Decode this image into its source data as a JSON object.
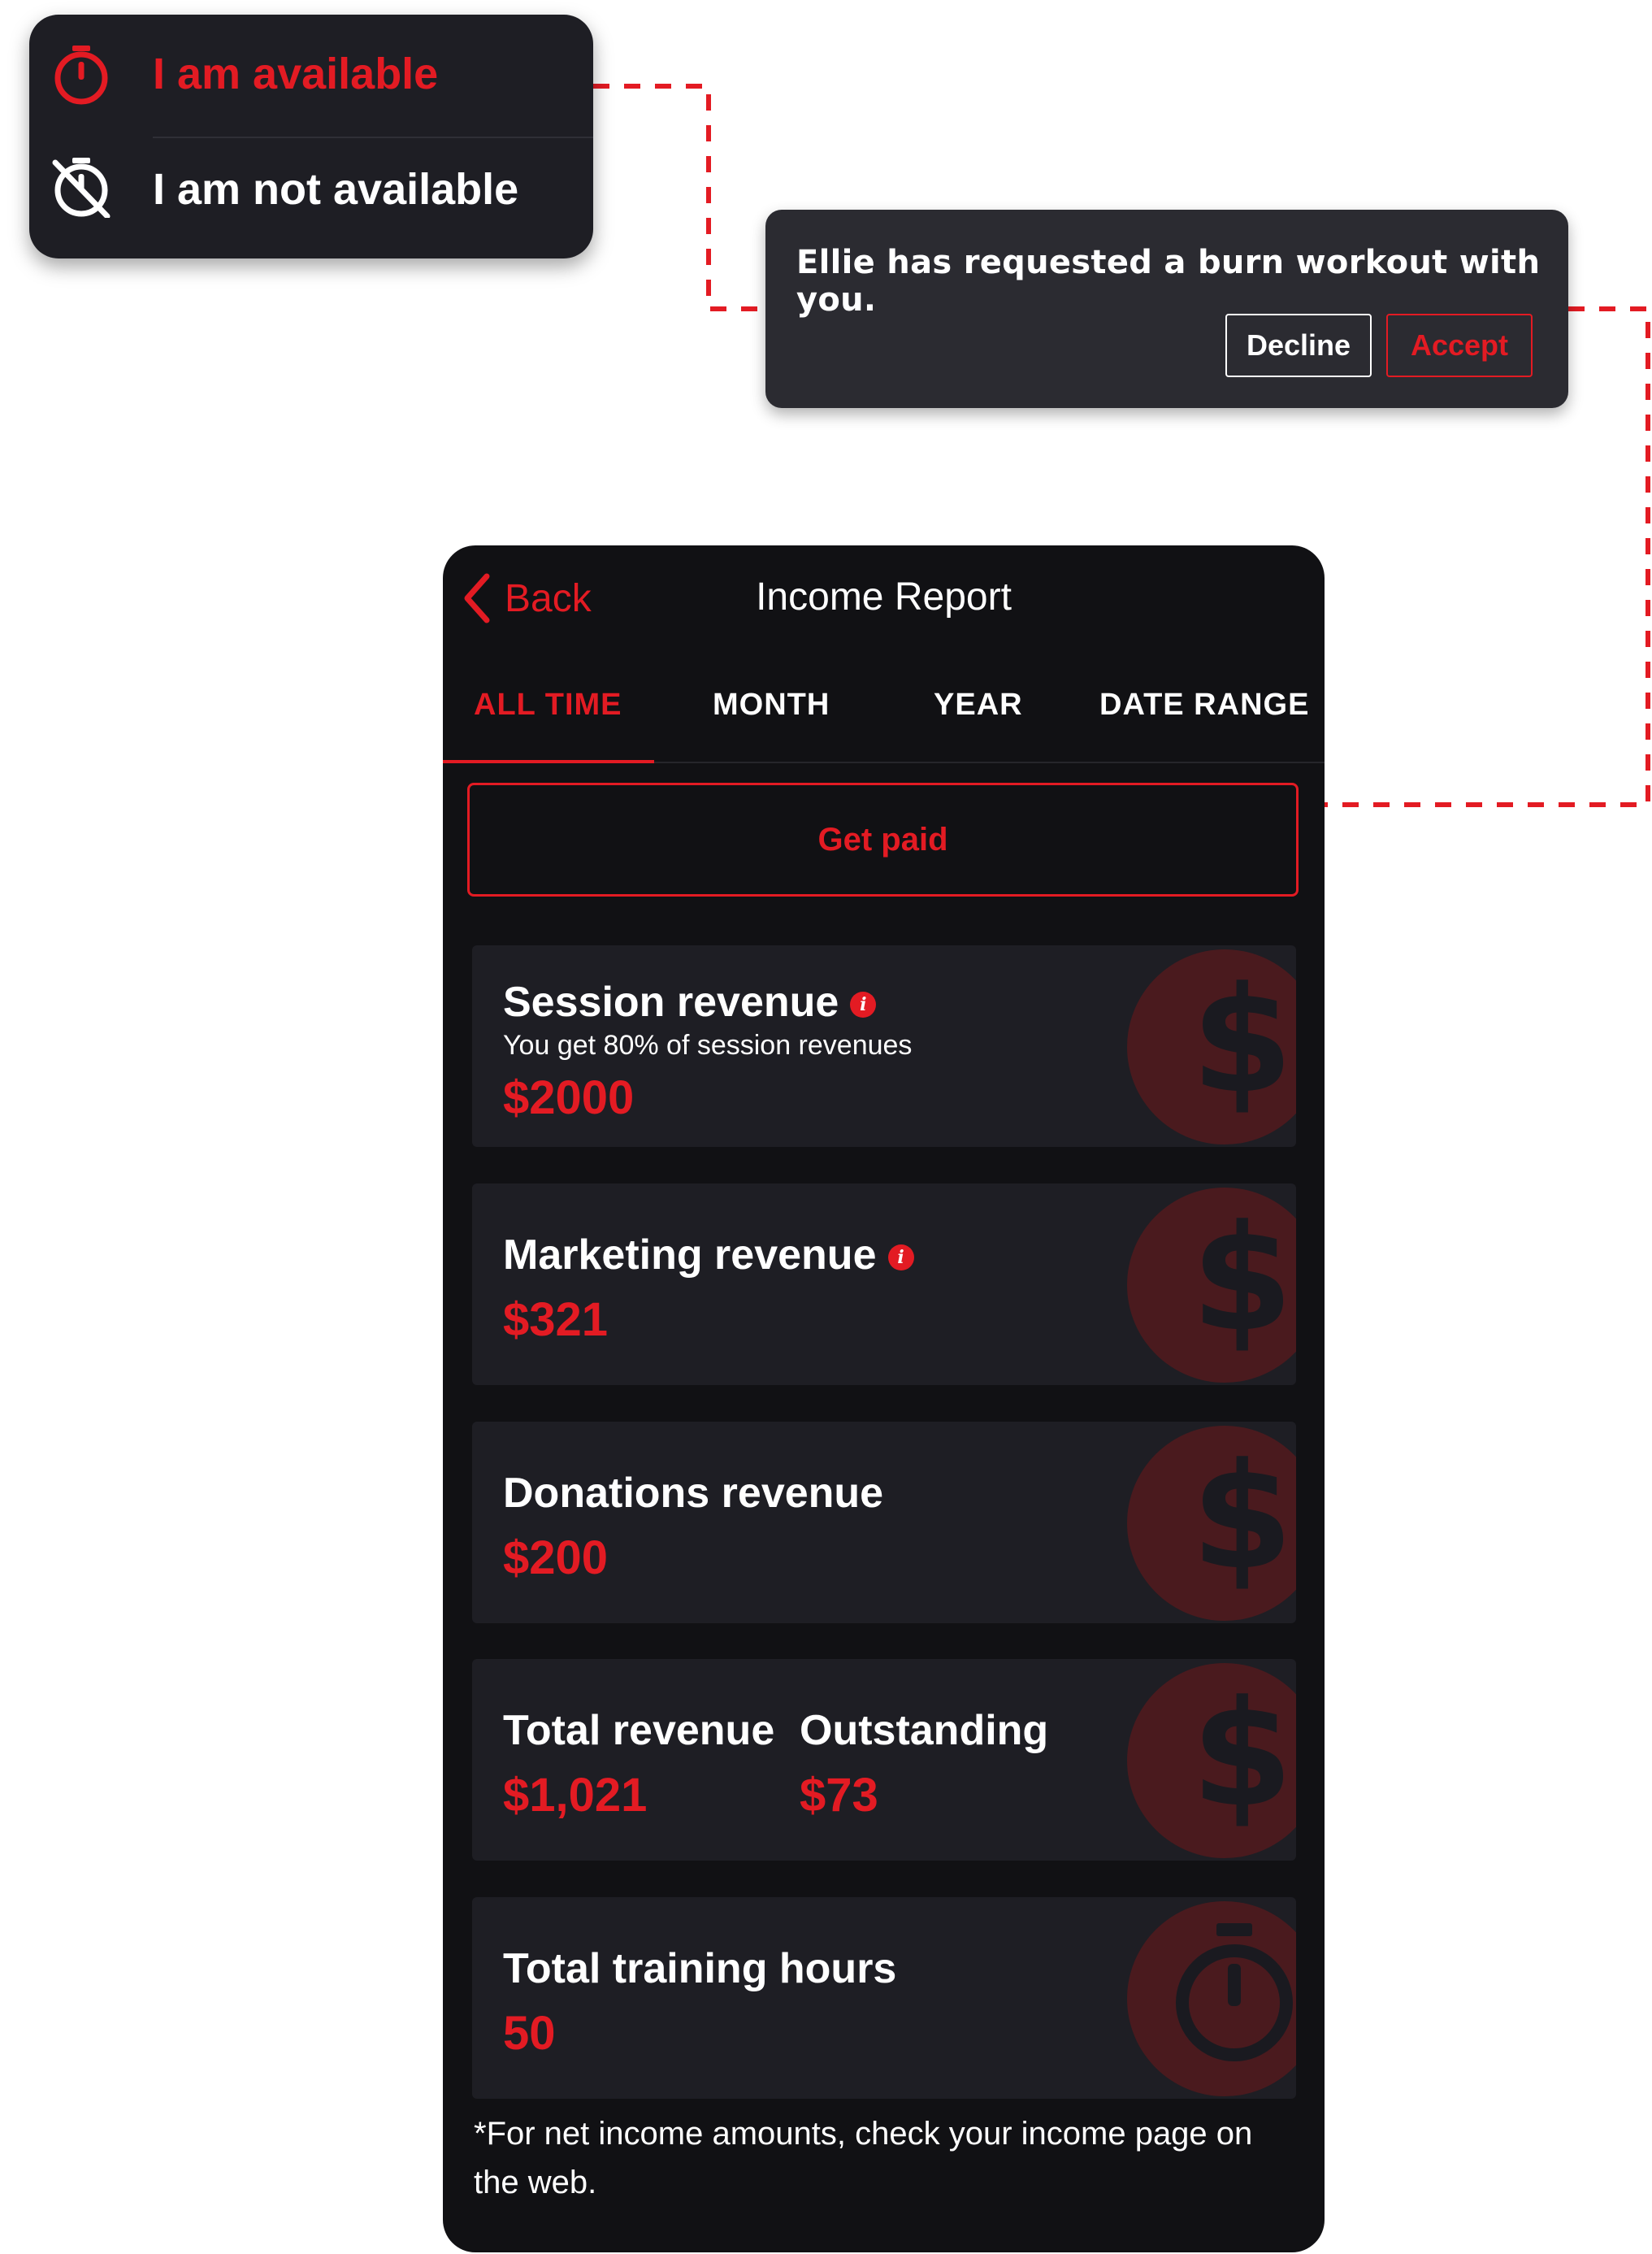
{
  "availability_menu": {
    "items": [
      {
        "label": "I am available",
        "icon": "stopwatch-icon",
        "color": "#e31b23"
      },
      {
        "label": "I am not available",
        "icon": "stopwatch-off-icon",
        "color": "#ffffff"
      }
    ]
  },
  "notification": {
    "message": "Ellie has requested a burn workout with you.",
    "decline_label": "Decline",
    "accept_label": "Accept"
  },
  "header": {
    "back_label": "Back",
    "title": "Income Report"
  },
  "tabs": [
    {
      "label": "ALL TIME",
      "active": true
    },
    {
      "label": "MONTH",
      "active": false
    },
    {
      "label": "YEAR",
      "active": false
    },
    {
      "label": "DATE RANGE",
      "active": false
    }
  ],
  "get_paid_label": "Get paid",
  "cards": {
    "session": {
      "title": "Session revenue",
      "subtitle": "You get 80% of session revenues",
      "value": "$2000",
      "icon": "dollar-icon"
    },
    "marketing": {
      "title": "Marketing revenue",
      "value": "$321",
      "icon": "dollar-icon"
    },
    "donations": {
      "title": "Donations revenue",
      "value": "$200",
      "icon": "dollar-icon"
    },
    "totals": {
      "total_title": "Total revenue",
      "total_value": "$1,021",
      "outstanding_title": "Outstanding",
      "outstanding_value": "$73",
      "icon": "dollar-icon"
    },
    "hours": {
      "title": "Total training hours",
      "value": "50",
      "icon": "stopwatch-icon"
    }
  },
  "footnote": "*For net income amounts, check your income page on the web.",
  "colors": {
    "accent": "#e31b23",
    "background": "#111114",
    "card": "#1e1e24"
  }
}
